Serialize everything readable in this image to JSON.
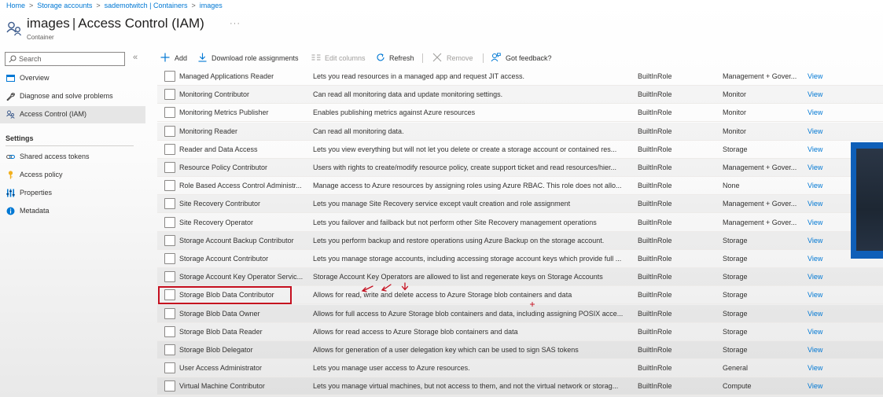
{
  "breadcrumb": [
    "Home",
    "Storage accounts",
    "sademotwitch | Containers",
    "images"
  ],
  "header": {
    "resource_name": "images",
    "pipe": "|",
    "page_name": "Access Control (IAM)",
    "subtitle": "Container",
    "more": "···"
  },
  "sidebar": {
    "search_placeholder": "Search",
    "collapse": "«",
    "items": [
      {
        "label": "Overview",
        "icon": "overview-icon"
      },
      {
        "label": "Diagnose and solve problems",
        "icon": "wrench-icon"
      },
      {
        "label": "Access Control (IAM)",
        "icon": "people-icon",
        "active": true
      }
    ],
    "settings_heading": "Settings",
    "settings_items": [
      {
        "label": "Shared access tokens",
        "icon": "link-icon"
      },
      {
        "label": "Access policy",
        "icon": "key-icon"
      },
      {
        "label": "Properties",
        "icon": "properties-icon"
      },
      {
        "label": "Metadata",
        "icon": "info-icon"
      }
    ]
  },
  "toolbar": {
    "add": "Add",
    "download": "Download role assignments",
    "edit_columns": "Edit columns",
    "refresh": "Refresh",
    "remove": "Remove",
    "feedback": "Got feedback?"
  },
  "roles": [
    {
      "name": "Managed Applications Reader",
      "description": "Lets you read resources in a managed app and request JIT access.",
      "type": "BuiltInRole",
      "category": "Management + Gover...",
      "action": "View"
    },
    {
      "name": "Monitoring Contributor",
      "description": "Can read all monitoring data and update monitoring settings.",
      "type": "BuiltInRole",
      "category": "Monitor",
      "action": "View"
    },
    {
      "name": "Monitoring Metrics Publisher",
      "description": "Enables publishing metrics against Azure resources",
      "type": "BuiltInRole",
      "category": "Monitor",
      "action": "View"
    },
    {
      "name": "Monitoring Reader",
      "description": "Can read all monitoring data.",
      "type": "BuiltInRole",
      "category": "Monitor",
      "action": "View"
    },
    {
      "name": "Reader and Data Access",
      "description": "Lets you view everything but will not let you delete or create a storage account or contained res...",
      "type": "BuiltInRole",
      "category": "Storage",
      "action": "View"
    },
    {
      "name": "Resource Policy Contributor",
      "description": "Users with rights to create/modify resource policy, create support ticket and read resources/hier...",
      "type": "BuiltInRole",
      "category": "Management + Gover...",
      "action": "View"
    },
    {
      "name": "Role Based Access Control Administr...",
      "description": "Manage access to Azure resources by assigning roles using Azure RBAC. This role does not allo...",
      "type": "BuiltInRole",
      "category": "None",
      "action": "View"
    },
    {
      "name": "Site Recovery Contributor",
      "description": "Lets you manage Site Recovery service except vault creation and role assignment",
      "type": "BuiltInRole",
      "category": "Management + Gover...",
      "action": "View"
    },
    {
      "name": "Site Recovery Operator",
      "description": "Lets you failover and failback but not perform other Site Recovery management operations",
      "type": "BuiltInRole",
      "category": "Management + Gover...",
      "action": "View"
    },
    {
      "name": "Storage Account Backup Contributor",
      "description": "Lets you perform backup and restore operations using Azure Backup on the storage account.",
      "type": "BuiltInRole",
      "category": "Storage",
      "action": "View"
    },
    {
      "name": "Storage Account Contributor",
      "description": "Lets you manage storage accounts, including accessing storage account keys which provide full ...",
      "type": "BuiltInRole",
      "category": "Storage",
      "action": "View"
    },
    {
      "name": "Storage Account Key Operator Servic...",
      "description": "Storage Account Key Operators are allowed to list and regenerate keys on Storage Accounts",
      "type": "BuiltInRole",
      "category": "Storage",
      "action": "View"
    },
    {
      "name": "Storage Blob Data Contributor",
      "description": "Allows for read, write and delete access to Azure Storage blob containers and data",
      "type": "BuiltInRole",
      "category": "Storage",
      "action": "View"
    },
    {
      "name": "Storage Blob Data Owner",
      "description": "Allows for full access to Azure Storage blob containers and data, including assigning POSIX acce...",
      "type": "BuiltInRole",
      "category": "Storage",
      "action": "View"
    },
    {
      "name": "Storage Blob Data Reader",
      "description": "Allows for read access to Azure Storage blob containers and data",
      "type": "BuiltInRole",
      "category": "Storage",
      "action": "View"
    },
    {
      "name": "Storage Blob Delegator",
      "description": "Allows for generation of a user delegation key which can be used to sign SAS tokens",
      "type": "BuiltInRole",
      "category": "Storage",
      "action": "View"
    },
    {
      "name": "User Access Administrator",
      "description": "Lets you manage user access to Azure resources.",
      "type": "BuiltInRole",
      "category": "General",
      "action": "View"
    },
    {
      "name": "Virtual Machine Contributor",
      "description": "Lets you manage virtual machines, but not access to them, and not the virtual network or storag...",
      "type": "BuiltInRole",
      "category": "Compute",
      "action": "View"
    }
  ],
  "colors": {
    "accent": "#0078d4",
    "highlight": "#c50f1f"
  }
}
